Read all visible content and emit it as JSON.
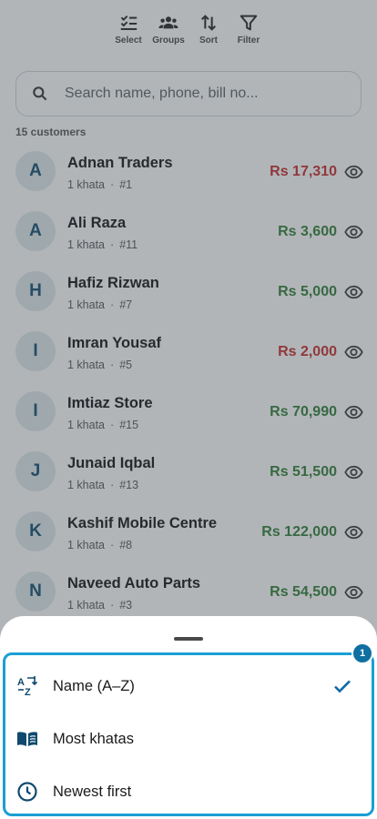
{
  "toolbar": {
    "select": {
      "label": "Select",
      "icon": "checklist-icon"
    },
    "groups": {
      "label": "Groups",
      "icon": "groups-icon"
    },
    "sort": {
      "label": "Sort",
      "icon": "sort-icon"
    },
    "filter": {
      "label": "Filter",
      "icon": "filter-icon"
    }
  },
  "search": {
    "placeholder": "Search name, phone, bill no..."
  },
  "customer_count": "15 customers",
  "customers": [
    {
      "initial": "A",
      "name": "Adnan Traders",
      "khata": "1 khata",
      "id": "#1",
      "amount": "Rs 17,310",
      "status": "red"
    },
    {
      "initial": "A",
      "name": "Ali Raza",
      "khata": "1 khata",
      "id": "#11",
      "amount": "Rs 3,600",
      "status": "green"
    },
    {
      "initial": "H",
      "name": "Hafiz Rizwan",
      "khata": "1 khata",
      "id": "#7",
      "amount": "Rs 5,000",
      "status": "green"
    },
    {
      "initial": "I",
      "name": "Imran Yousaf",
      "khata": "1 khata",
      "id": "#5",
      "amount": "Rs 2,000",
      "status": "red"
    },
    {
      "initial": "I",
      "name": "Imtiaz Store",
      "khata": "1 khata",
      "id": "#15",
      "amount": "Rs 70,990",
      "status": "green"
    },
    {
      "initial": "J",
      "name": "Junaid Iqbal",
      "khata": "1 khata",
      "id": "#13",
      "amount": "Rs 51,500",
      "status": "green"
    },
    {
      "initial": "K",
      "name": "Kashif Mobile Centre",
      "khata": "1 khata",
      "id": "#8",
      "amount": "Rs 122,000",
      "status": "green"
    },
    {
      "initial": "N",
      "name": "Naveed Auto Parts",
      "khata": "1 khata",
      "id": "#3",
      "amount": "Rs 54,500",
      "status": "green"
    }
  ],
  "sort_sheet": {
    "badge": "1",
    "options": [
      {
        "label": "Name (A–Z)",
        "icon": "sort-alpha-icon",
        "selected": true
      },
      {
        "label": "Most khatas",
        "icon": "book-icon",
        "selected": false
      },
      {
        "label": "Newest first",
        "icon": "clock-icon",
        "selected": false
      }
    ]
  },
  "colors": {
    "accent": "#0f4a6e",
    "negative": "#c62828",
    "positive": "#2e7d32",
    "focus": "#1a9fd5"
  }
}
